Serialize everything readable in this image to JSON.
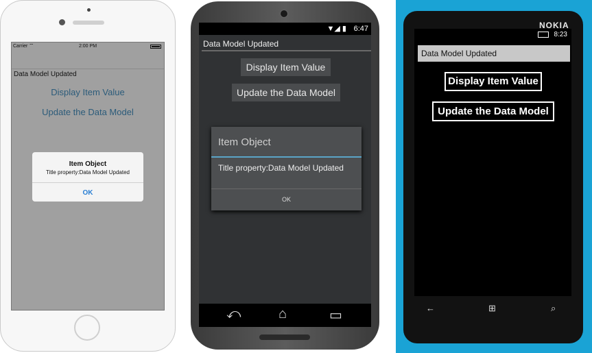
{
  "ios": {
    "carrier": "Carrier",
    "wifi_icon": "wifi-icon",
    "time": "2:00 PM",
    "label": "Data Model Updated",
    "buttons": [
      "Display Item Value",
      "Update the Data Model"
    ],
    "alert": {
      "title": "Item Object",
      "message": "Title property:Data Model Updated",
      "ok": "OK"
    }
  },
  "android": {
    "status_icons": "▼◢ ▮",
    "time": "6:47",
    "label": "Data Model Updated",
    "buttons": [
      "Display Item Value",
      "Update the Data Model"
    ],
    "dialog": {
      "title": "Item Object",
      "message": "Title property:Data Model Updated",
      "ok": "OK"
    },
    "nav_icons": [
      "back-icon",
      "home-icon",
      "recents-icon"
    ]
  },
  "windows_phone": {
    "brand": "NOKIA",
    "time": "8:23",
    "label": "Data Model Updated",
    "buttons": [
      "Display Item Value",
      "Update the Data Model"
    ],
    "nav_icons": [
      "back-icon",
      "windows-start-icon",
      "search-icon"
    ]
  },
  "colors": {
    "ios_link": "#2a7fd4",
    "android_accent": "#5aa5c8",
    "nokia_frame": "#1aa3d5"
  }
}
